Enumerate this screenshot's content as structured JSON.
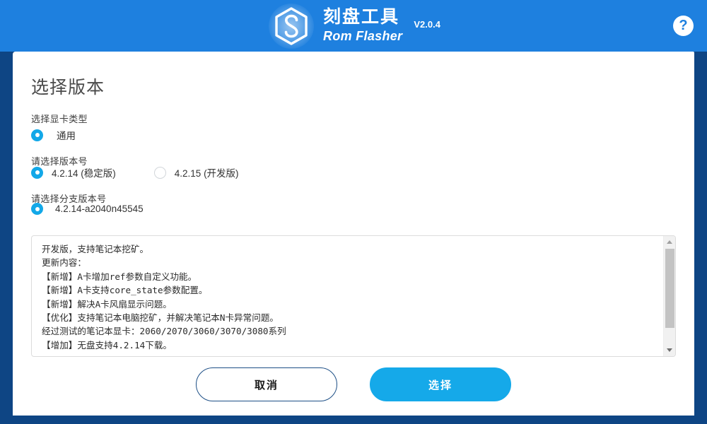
{
  "header": {
    "logo_icon": "hexagon-s-logo",
    "title_cn": "刻盘工具",
    "title_en": "Rom Flasher",
    "version": "V2.0.4",
    "help_icon": "question-mark-icon",
    "background_color": "#1E80DF"
  },
  "page": {
    "title": "选择版本",
    "card_background": "#FFFFFF",
    "window_border_color": "#0E4584"
  },
  "form": {
    "gpu_type": {
      "label": "选择显卡类型",
      "options": [
        {
          "label": "通用",
          "selected": true
        }
      ]
    },
    "version": {
      "label": "请选择版本号",
      "options": [
        {
          "label": "4.2.14 (稳定版)",
          "selected": true
        },
        {
          "label": "4.2.15 (开发版)",
          "selected": false
        }
      ]
    },
    "branch": {
      "label": "请选择分支版本号",
      "options": [
        {
          "label": "4.2.14-a2040n45545",
          "selected": true
        }
      ]
    }
  },
  "changelog": {
    "text": "开发版，支持笔记本挖矿。\n更新内容：\n【新增】A卡增加ref参数自定义功能。\n【新增】A卡支持core_state参数配置。\n【新增】解决A卡风扇显示问题。\n【优化】支持笔记本电脑挖矿，并解决笔记本N卡异常问题。\n经过测试的笔记本显卡：2060/2070/3060/3070/3080系列\n【增加】无盘支持4.2.14下载。",
    "scrollbar": {
      "up_icon": "triangle-up-icon",
      "down_icon": "triangle-down-icon"
    }
  },
  "footer": {
    "cancel_label": "取消",
    "select_label": "选择",
    "select_color": "#15A9E9",
    "cancel_border_color": "#1D4F86"
  }
}
